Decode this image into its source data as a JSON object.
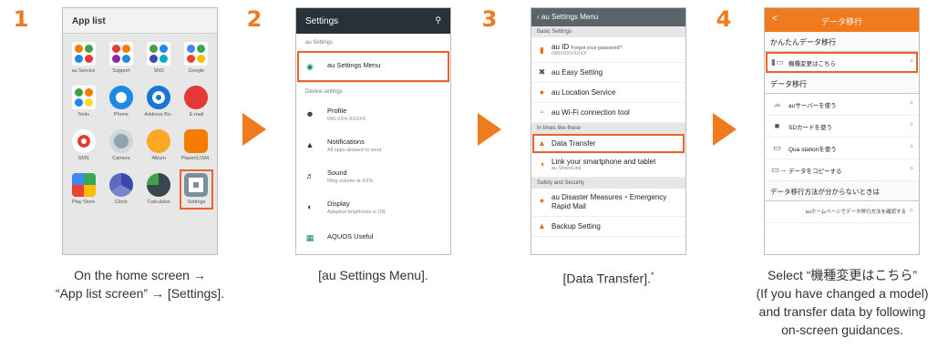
{
  "steps": [
    {
      "num": "1",
      "caption_lines": [
        "On the home screen →",
        "“App list screen” → [Settings]."
      ]
    },
    {
      "num": "2",
      "caption_lines": [
        "[au Settings Menu]."
      ]
    },
    {
      "num": "3",
      "caption_lines": [
        "[Data Transfer]."
      ],
      "caption_mark": "*"
    },
    {
      "num": "4",
      "caption_lines": [
        "Select “機種変更はこちら”",
        "(If you have changed a model)",
        "and transfer data by following",
        "on-screen guidances."
      ]
    }
  ],
  "screen1": {
    "title": "App list",
    "apps": [
      {
        "label": "au Service",
        "color": "#ffffff"
      },
      {
        "label": "Support",
        "color": "#ffffff"
      },
      {
        "label": "SNS",
        "color": "#ffffff"
      },
      {
        "label": "Google",
        "color": "#ffffff"
      },
      {
        "label": "Tools",
        "color": "#ffffff"
      },
      {
        "label": "Phone",
        "color": "#1e88e5"
      },
      {
        "label": "Address Bo..",
        "color": "#1976d2"
      },
      {
        "label": "E-mail",
        "color": "#e53935"
      },
      {
        "label": "SMS",
        "color": "#ffffff"
      },
      {
        "label": "Camera",
        "color": "#b0bec5"
      },
      {
        "label": "Album",
        "color": "#ffa726"
      },
      {
        "label": "Player(LISM..",
        "color": "#f57c00"
      },
      {
        "label": "Play Store",
        "color": "#ffffff"
      },
      {
        "label": "Clock",
        "color": "#5c6bc0"
      },
      {
        "label": "Calculator",
        "color": "#37474f"
      },
      {
        "label": "Settings",
        "color": "#78909c"
      }
    ]
  },
  "screen2": {
    "title": "Settings",
    "section1": "au Settings",
    "highlight_item": "au Settings Menu",
    "section2": "Device settings",
    "items": [
      {
        "title": "Profile",
        "sub": "090-XXX-XXXXX",
        "icon": "person-icon"
      },
      {
        "title": "Notifications",
        "sub": "All apps allowed to send",
        "icon": "bell-icon"
      },
      {
        "title": "Sound",
        "sub": "Ring volume at XX%",
        "icon": "speaker-icon"
      },
      {
        "title": "Display",
        "sub": "Adaptive brightness is ON",
        "icon": "brightness-icon"
      },
      {
        "title": "AQUOS Useful",
        "sub": "",
        "icon": "grid-icon"
      }
    ]
  },
  "screen3": {
    "title": "‹ au Settings Menu",
    "section_basic": "Basic Settings",
    "au_id": "au ID",
    "au_id_note": "Forgot your password?",
    "au_id_sub": "090XXXXXXXX",
    "easy": "au Easy Setting",
    "location": "au Location Service",
    "wifi": "au Wi-Fi connection tool",
    "section_times": "In times like these",
    "data_transfer": "Data Transfer",
    "link": "Link your smartphone and tablet",
    "link_sub": "au ShareLink",
    "section_safety": "Safety and Security",
    "disaster": "au Disaster Measures・Emergency Rapid Mail",
    "backup": "Backup Setting"
  },
  "screen4": {
    "title": "データ移行",
    "back": "<",
    "section1": "かんたんデータ移行",
    "highlight_item": "機種変更はこちら",
    "section2": "データ移行",
    "items": [
      "auサーバーを使う",
      "SDカードを使う",
      "Qua stationを使う",
      "データをコピーする"
    ],
    "section3": "データ移行方法が分からないときは",
    "link_row": "auホームページでデータ移行方法を確認する",
    "chevron": ">"
  },
  "colors": {
    "accent": "#f07a1e",
    "highlight": "#e8642b",
    "settings_bar": "#263238"
  }
}
